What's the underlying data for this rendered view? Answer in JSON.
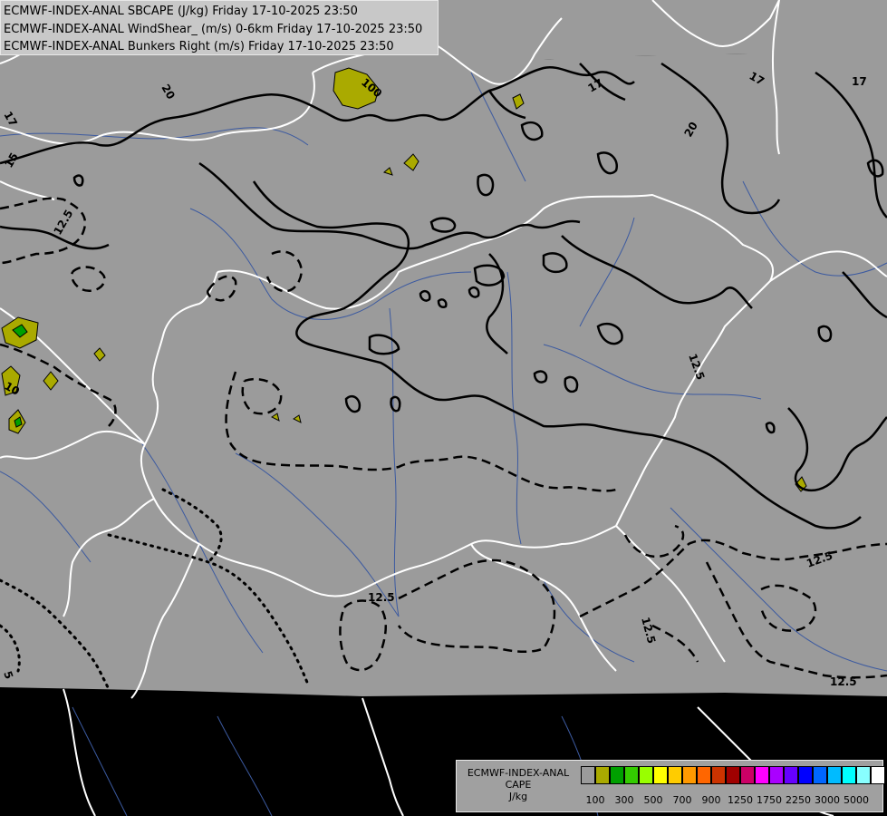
{
  "titles": [
    "ECMWF-INDEX-ANAL SBCAPE (J/kg) Friday 17-10-2025 23:50",
    "ECMWF-INDEX-ANAL WindShear_ (m/s) 0-6km Friday 17-10-2025 23:50",
    "ECMWF-INDEX-ANAL Bunkers Right (m/s) Friday 17-10-2025 23:50"
  ],
  "legend": {
    "title_lines": [
      "ECMWF-INDEX-ANAL",
      "CAPE",
      "J/kg"
    ],
    "swatch_colors": [
      "#9b9b9b",
      "#aaaa00",
      "#00a000",
      "#33cc00",
      "#99ff00",
      "#ffff00",
      "#ffcc00",
      "#ff9900",
      "#ff6600",
      "#cc3300",
      "#a00000",
      "#cc0066",
      "#ff00ff",
      "#aa00ff",
      "#6600ff",
      "#0000ff",
      "#0066ff",
      "#00bbff",
      "#00ffff",
      "#88ffff",
      "#ffffff"
    ],
    "tick_labels": [
      "100",
      "300",
      "500",
      "700",
      "900",
      "1250",
      "1750",
      "2250",
      "3000",
      "5000"
    ]
  },
  "contour_labels": [
    "100",
    "20",
    "17",
    "15",
    "12.5",
    "17",
    "20",
    "17",
    "17",
    "12.5",
    "10",
    "12.5",
    "12.5",
    "12.5",
    "12.5",
    "5"
  ],
  "colors": {
    "outside": "#000000",
    "domain_fill": "#9b9b9b",
    "cape_low": "#aaaa00",
    "cape_green": "#00a000",
    "border": "#ffffff",
    "river": "#3c5aa0",
    "contour": "#000000"
  }
}
